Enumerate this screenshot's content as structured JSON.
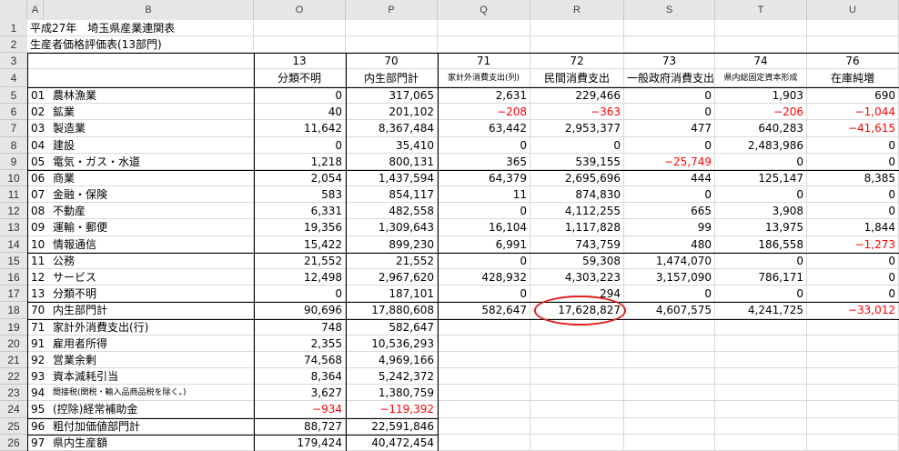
{
  "columns": [
    "A",
    "B",
    "O",
    "P",
    "Q",
    "R",
    "S",
    "T",
    "U"
  ],
  "title1": "平成27年　埼玉県産業連関表",
  "title2": "生産者価格評価表(13部門)",
  "headers": {
    "O": {
      "code": "13",
      "name": "分類不明"
    },
    "P": {
      "code": "70",
      "name": "内生部門計"
    },
    "Q": {
      "code": "71",
      "name": "家計外消費支出(列)"
    },
    "R": {
      "code": "72",
      "name": "民間消費支出"
    },
    "S": {
      "code": "73",
      "name": "一般政府消費支出"
    },
    "T": {
      "code": "74",
      "name": "県内総固定資本形成"
    },
    "U": {
      "code": "76",
      "name": "在庫純増"
    }
  },
  "rows": [
    {
      "n": "5",
      "code": "01",
      "name": "農林漁業",
      "O": "0",
      "P": "317,065",
      "Q": "2,631",
      "R": "229,466",
      "S": "0",
      "T": "1,903",
      "U": "690"
    },
    {
      "n": "6",
      "code": "02",
      "name": "鉱業",
      "O": "40",
      "P": "201,102",
      "Q": "−208",
      "R": "−363",
      "S": "0",
      "T": "−206",
      "U": "−1,044"
    },
    {
      "n": "7",
      "code": "03",
      "name": "製造業",
      "O": "11,642",
      "P": "8,367,484",
      "Q": "63,442",
      "R": "2,953,377",
      "S": "477",
      "T": "640,283",
      "U": "−41,615"
    },
    {
      "n": "8",
      "code": "04",
      "name": "建設",
      "O": "0",
      "P": "35,410",
      "Q": "0",
      "R": "0",
      "S": "0",
      "T": "2,483,986",
      "U": "0"
    },
    {
      "n": "9",
      "code": "05",
      "name": "電気・ガス・水道",
      "O": "1,218",
      "P": "800,131",
      "Q": "365",
      "R": "539,155",
      "S": "−25,749",
      "T": "0",
      "U": "0"
    },
    {
      "n": "10",
      "code": "06",
      "name": "商業",
      "O": "2,054",
      "P": "1,437,594",
      "Q": "64,379",
      "R": "2,695,696",
      "S": "444",
      "T": "125,147",
      "U": "8,385"
    },
    {
      "n": "11",
      "code": "07",
      "name": "金融・保険",
      "O": "583",
      "P": "854,117",
      "Q": "11",
      "R": "874,830",
      "S": "0",
      "T": "0",
      "U": "0"
    },
    {
      "n": "12",
      "code": "08",
      "name": "不動産",
      "O": "6,331",
      "P": "482,558",
      "Q": "0",
      "R": "4,112,255",
      "S": "665",
      "T": "3,908",
      "U": "0"
    },
    {
      "n": "13",
      "code": "09",
      "name": "運輸・郵便",
      "O": "19,356",
      "P": "1,309,643",
      "Q": "16,104",
      "R": "1,117,828",
      "S": "99",
      "T": "13,975",
      "U": "1,844"
    },
    {
      "n": "14",
      "code": "10",
      "name": "情報通信",
      "O": "15,422",
      "P": "899,230",
      "Q": "6,991",
      "R": "743,759",
      "S": "480",
      "T": "186,558",
      "U": "−1,273"
    },
    {
      "n": "15",
      "code": "11",
      "name": "公務",
      "O": "21,552",
      "P": "21,552",
      "Q": "0",
      "R": "59,308",
      "S": "1,474,070",
      "T": "0",
      "U": "0"
    },
    {
      "n": "16",
      "code": "12",
      "name": "サービス",
      "O": "12,498",
      "P": "2,967,620",
      "Q": "428,932",
      "R": "4,303,223",
      "S": "3,157,090",
      "T": "786,171",
      "U": "0"
    },
    {
      "n": "17",
      "code": "13",
      "name": "分類不明",
      "O": "0",
      "P": "187,101",
      "Q": "0",
      "R": "294",
      "S": "0",
      "T": "0",
      "U": "0"
    },
    {
      "n": "18",
      "code": "70",
      "name": "内生部門計",
      "O": "90,696",
      "P": "17,880,608",
      "Q": "582,647",
      "R": "17,628,827",
      "S": "4,607,575",
      "T": "4,241,725",
      "U": "−33,012"
    },
    {
      "n": "19",
      "code": "71",
      "name": "家計外消費支出(行)",
      "O": "748",
      "P": "582,647"
    },
    {
      "n": "20",
      "code": "91",
      "name": "雇用者所得",
      "O": "2,355",
      "P": "10,536,293"
    },
    {
      "n": "21",
      "code": "92",
      "name": "営業余剰",
      "O": "74,568",
      "P": "4,969,166"
    },
    {
      "n": "22",
      "code": "93",
      "name": "資本減耗引当",
      "O": "8,364",
      "P": "5,242,372"
    },
    {
      "n": "23",
      "code": "94",
      "name": "間接税(関税・輸入品商品税を除く。)",
      "O": "3,627",
      "P": "1,380,759"
    },
    {
      "n": "24",
      "code": "95",
      "name": "(控除)経常補助金",
      "O": "−934",
      "P": "−119,392"
    },
    {
      "n": "25",
      "code": "96",
      "name": "粗付加価値部門計",
      "O": "88,727",
      "P": "22,591,846"
    },
    {
      "n": "26",
      "code": "97",
      "name": "県内生産額",
      "O": "179,424",
      "P": "40,472,454"
    }
  ],
  "highlight": {
    "row": "18",
    "col": "R",
    "color": "#e02020"
  },
  "negative_color": "#ff0000"
}
